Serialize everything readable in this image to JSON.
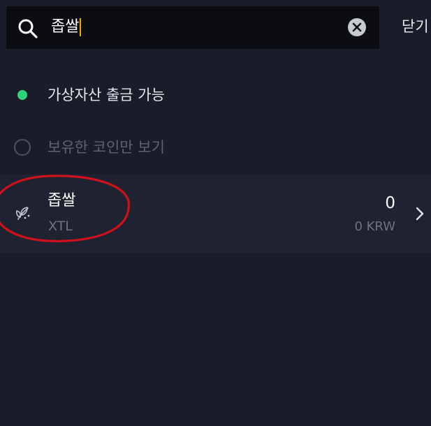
{
  "search": {
    "query": "좁쌀",
    "icon": "search-icon",
    "clear_icon": "clear-icon"
  },
  "header": {
    "close_label": "닫기"
  },
  "filters": [
    {
      "label": "가상자산 출금 가능",
      "active": true
    },
    {
      "label": "보유한 코인만 보기",
      "active": false
    }
  ],
  "results": [
    {
      "name": "좁쌀",
      "symbol": "XTL",
      "amount": "0",
      "krw_value": "0 KRW",
      "icon": "leaf-coin-icon"
    }
  ],
  "colors": {
    "background": "#1a1d29",
    "search_bg": "#0b0d13",
    "row_bg": "#1f2230",
    "accent_green": "#2fd07f",
    "caret": "#f2a900",
    "annotation_red": "#d0101a"
  }
}
